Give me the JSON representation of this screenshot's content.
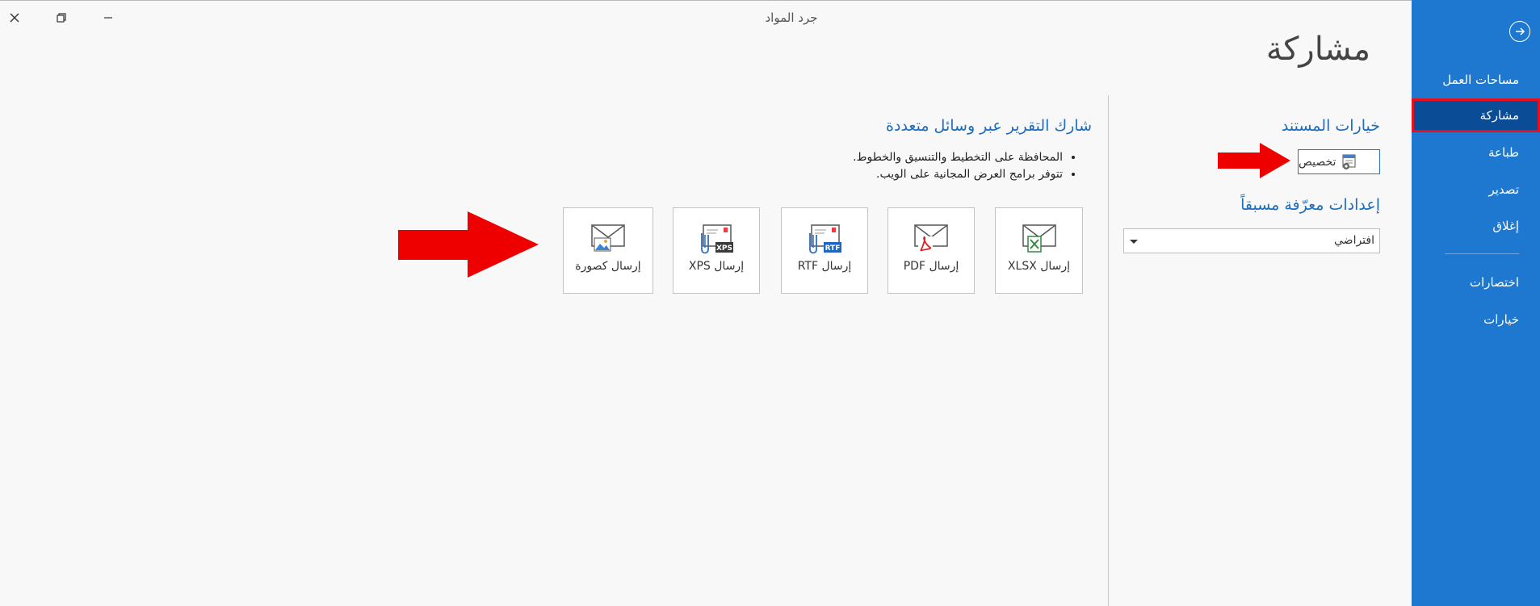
{
  "window": {
    "title": "جرد المواد"
  },
  "sidebar": {
    "items": [
      {
        "label": "مساحات العمل",
        "active": false
      },
      {
        "label": "مشاركة",
        "active": true
      },
      {
        "label": "طباعة",
        "active": false
      },
      {
        "label": "تصدير",
        "active": false
      },
      {
        "label": "إغلاق",
        "active": false
      },
      {
        "label": "اختصارات",
        "active": false
      },
      {
        "label": "خيارات",
        "active": false
      }
    ]
  },
  "page": {
    "title": "مشاركة"
  },
  "doc_options": {
    "heading": "خيارات المستند",
    "customize_label": "تخصيص",
    "presets_heading": "إعدادات معرّفة مسبقاً",
    "preset_value": "افتراضي"
  },
  "share": {
    "heading": "شارك التقرير عبر وسائل متعددة",
    "bullets": [
      "المحافظة على التخطيط والتنسيق والخطوط.",
      "تتوفر برامج العرض المجانية على الويب."
    ],
    "tiles": [
      {
        "label": "إرسال XLSX",
        "icon": "xlsx-mail-icon"
      },
      {
        "label": "إرسال PDF",
        "icon": "pdf-mail-icon"
      },
      {
        "label": "إرسال RTF",
        "icon": "rtf-mail-icon",
        "badge": "RTF"
      },
      {
        "label": "إرسال XPS",
        "icon": "xps-mail-icon",
        "badge": "XPS"
      },
      {
        "label": "إرسال كصورة",
        "icon": "image-mail-icon"
      }
    ]
  },
  "colors": {
    "sidebar": "#1f78d0",
    "active_item": "#0a4c95",
    "highlight": "#e8101e",
    "accent_text": "#1c6cc0",
    "arrow": "#ee0000"
  }
}
